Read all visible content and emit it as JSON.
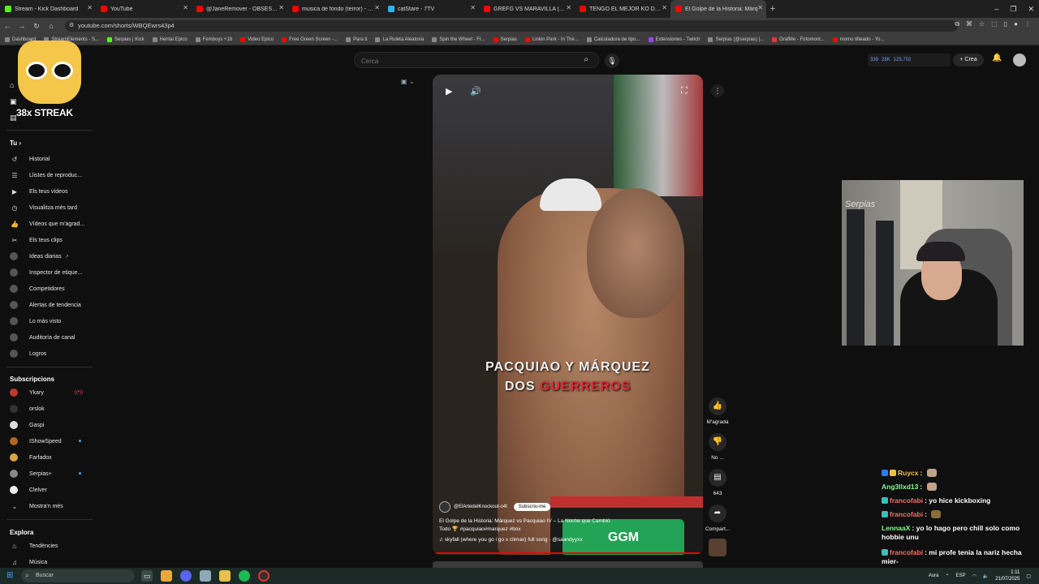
{
  "browser": {
    "tabs": [
      {
        "title": "Stream - Kick Dashboard",
        "color": "#53fc18"
      },
      {
        "title": "YouTube",
        "color": "#ff0000"
      },
      {
        "title": "@JaneRemover - OBSESSED PC",
        "color": "#ff0000"
      },
      {
        "title": "musica de fondo (terror) - YouT",
        "color": "#ff0000"
      },
      {
        "title": "catStare - 7TV",
        "color": "#29b6f6"
      },
      {
        "title": "GREFG VS MARAVILLA (CAMPE",
        "color": "#ff0000"
      },
      {
        "title": "TENGO EL MEJOR KO DEL AÑO",
        "color": "#ff0000"
      },
      {
        "title": "El Golpe de la Historia: Márq",
        "color": "#ff0000"
      }
    ],
    "new_tab": "+",
    "url": "youtube.com/shorts/WBQEwrs43p4",
    "bookmarks": [
      "Dashboard",
      "StreamElements - S...",
      "Serpias | Kick",
      "Hentai Epico",
      "Femboys +18",
      "Video Epico",
      "Free Green Screen -...",
      "Para ti",
      "La Ruleta Aleatoria",
      "Spin the Wheel - Fr...",
      "Serpias",
      "Linkin Park - In The...",
      "Calculadora de tipo...",
      "Extensiones - Twitch",
      "Serpias (@serpias) |...",
      "GrafMe - Fotomont...",
      "momo tilteado - Yo..."
    ]
  },
  "masthead": {
    "search_placeholder": "Cerca",
    "stats": [
      "339",
      "28K",
      "125,702"
    ],
    "create_label": "Crea"
  },
  "streak": {
    "label": "38x STREAK"
  },
  "sidebar": {
    "you_label": "Tu",
    "items": [
      {
        "label": "Historial",
        "icon": "history-icon"
      },
      {
        "label": "Llistes de reproduc...",
        "icon": "playlist-icon"
      },
      {
        "label": "Els teus vídeos",
        "icon": "your-videos-icon"
      },
      {
        "label": "Visualitza més tard",
        "icon": "watch-later-icon"
      },
      {
        "label": "Vídeos que m'agrad...",
        "icon": "liked-icon"
      },
      {
        "label": "Els teus clips",
        "icon": "clips-icon"
      },
      {
        "label": "Ideas diarias",
        "icon": "vidiq-icon"
      },
      {
        "label": "Inspector de etique...",
        "icon": "vidiq-icon"
      },
      {
        "label": "Competidores",
        "icon": "vidiq-icon"
      },
      {
        "label": "Alertas de tendencia",
        "icon": "vidiq-icon"
      },
      {
        "label": "Lo más visto",
        "icon": "vidiq-icon"
      },
      {
        "label": "Auditoría de canal",
        "icon": "vidiq-icon"
      },
      {
        "label": "Logros",
        "icon": "vidiq-icon"
      }
    ],
    "subs_title": "Subscripcions",
    "subs": [
      {
        "label": "Ykary",
        "color": "#c0392b"
      },
      {
        "label": "orslok",
        "color": "#333"
      },
      {
        "label": "Gaspi",
        "color": "#ddd"
      },
      {
        "label": "IShowSpeed",
        "color": "#b5651d"
      },
      {
        "label": "Farfadox",
        "color": "#d9a441"
      },
      {
        "label": "Serpias+",
        "color": "#888"
      },
      {
        "label": "Clelver",
        "color": "#eee"
      }
    ],
    "show_more": "Mostra'n més",
    "explore_title": "Explora",
    "explore": [
      {
        "label": "Tendències",
        "icon": "trending-icon"
      },
      {
        "label": "Música",
        "icon": "music-icon"
      }
    ]
  },
  "video": {
    "overlay_line1": "PACQUIAO Y MÁRQUEZ",
    "overlay_line2_a": "DOS",
    "overlay_line2_b": "GUERREROS",
    "belt_text": "GGM",
    "channel": "@ElArtedelKnockout-o4t",
    "subscribe": "Subscriu-me",
    "desc_line1": "El Golpe de la Historia: Márquez vs Pacquiao IV – La Noche que Cambió",
    "desc_line2": "Todo 🏆 #pacquiao#marquez #box",
    "song": "skyfall (where you go i go x climax) full song · @saandyyxx",
    "progress": 0.99
  },
  "actions": {
    "like": "M'agrada",
    "dislike": "No ...",
    "comments": "643",
    "share": "Compart..."
  },
  "webcam": {
    "label": "Serpias"
  },
  "chat": {
    "messages": [
      {
        "user": "Ruycx",
        "text": "",
        "ucolor": "#f0c040"
      },
      {
        "user": "Ang3llxd13",
        "text": "",
        "ucolor": "#7dff8a"
      },
      {
        "user": "francofabi",
        "text": "yo hice kickboxing",
        "ucolor": "#ff6b6b"
      },
      {
        "user": "francofabi",
        "text": "",
        "ucolor": "#ff6b6b"
      },
      {
        "user": "LennaaX",
        "text": "yo lo hago pero chill solo como hobbie unu",
        "ucolor": "#7dff8a"
      },
      {
        "user": "francofabi",
        "text": "mi profe tenia la nariz hecha mier-",
        "ucolor": "#ff6b6b"
      }
    ]
  },
  "taskbar": {
    "search": "Buscar",
    "lang": "ESP",
    "time": "1:11",
    "date": "21/07/2025",
    "now_playing": "Aura"
  }
}
